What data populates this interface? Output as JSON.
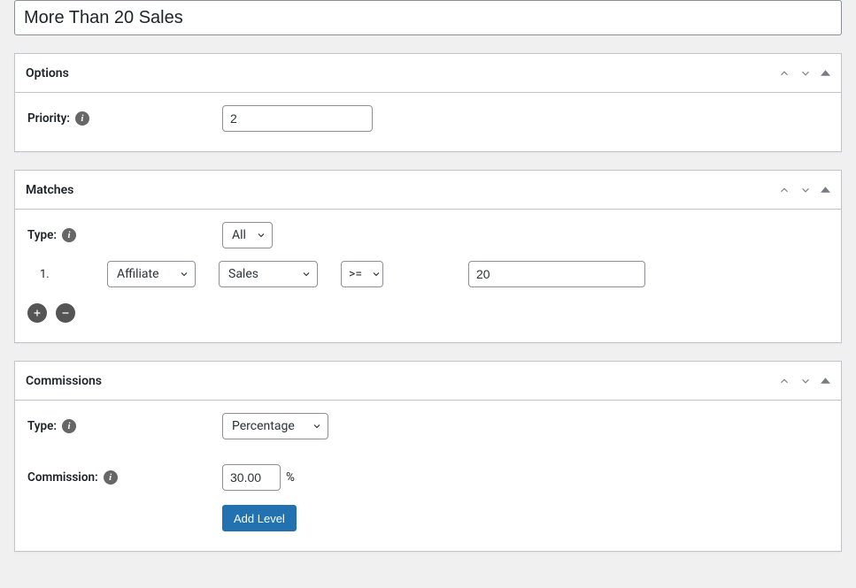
{
  "title": "More Than 20 Sales",
  "panels": {
    "options": {
      "heading": "Options",
      "priority_label": "Priority:",
      "priority_value": "2"
    },
    "matches": {
      "heading": "Matches",
      "type_label": "Type:",
      "type_value": "All",
      "row_num": "1.",
      "subject_value": "Affiliate",
      "metric_value": "Sales",
      "operator_value": ">=",
      "threshold_value": "20"
    },
    "commissions": {
      "heading": "Commissions",
      "type_label": "Type:",
      "type_value": "Percentage",
      "commission_label": "Commission:",
      "commission_value": "30.00",
      "commission_suffix": "%",
      "add_level_label": "Add Level"
    }
  }
}
